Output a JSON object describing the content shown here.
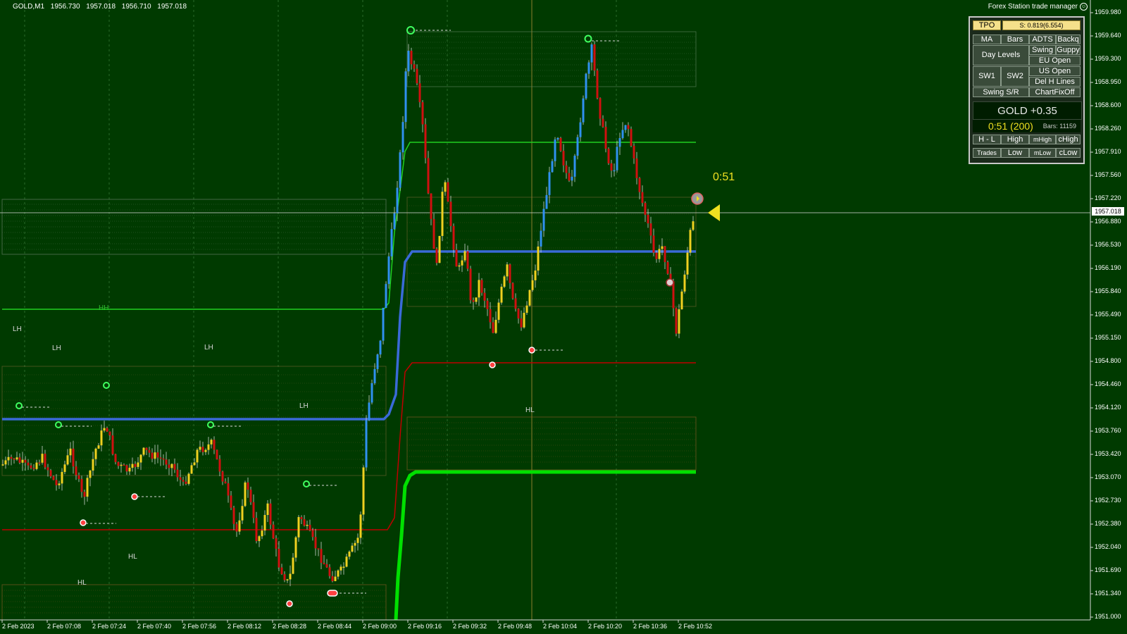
{
  "header": {
    "symbol": "GOLD,M1",
    "ohlc": [
      "1956.730",
      "1957.018",
      "1956.710",
      "1957.018"
    ]
  },
  "trade_manager": {
    "title": "Forex Station trade manager",
    "tpo_label": "TPO",
    "spread_label": "S: 0.819(6.554)",
    "buttons": {
      "ma": "MA",
      "bars": "Bars",
      "adts": "ADTS",
      "backq": "Backq",
      "day_levels": "Day Levels",
      "swing": "Swing",
      "guppy": "Guppy",
      "eu_open": "EU Open",
      "sw1": "SW1",
      "sw2": "SW2",
      "us_open": "US Open",
      "del_h_lines": "Del H Lines",
      "swing_sr": "Swing S/R",
      "chart_fix_off": "ChartFixOff",
      "h_l": "H - L",
      "high": "High",
      "mhigh": "mHigh",
      "chigh": "cHigh",
      "trades": "Trades",
      "low": "Low",
      "mlow": "mLow",
      "clow": "cLow"
    },
    "gold_display": "GOLD +0.35",
    "timer": "0:51 (200)",
    "bars_count": "Bars: 11159"
  },
  "countdown": "0:51",
  "price_axis": {
    "labels": [
      "1959.980",
      "1959.640",
      "1959.300",
      "1958.950",
      "1958.600",
      "1958.260",
      "1957.910",
      "1957.560",
      "1957.220",
      "1956.880",
      "1956.530",
      "1956.190",
      "1955.840",
      "1955.490",
      "1955.150",
      "1954.800",
      "1954.460",
      "1954.120",
      "1953.760",
      "1953.420",
      "1953.070",
      "1952.730",
      "1952.380",
      "1952.040",
      "1951.690",
      "1951.340",
      "1951.000"
    ],
    "current_price": "1957.018"
  },
  "time_axis": {
    "labels": [
      "2 Feb 2023",
      "2 Feb 07:08",
      "2 Feb 07:24",
      "2 Feb 07:40",
      "2 Feb 07:56",
      "2 Feb 08:12",
      "2 Feb 08:28",
      "2 Feb 08:44",
      "2 Feb 09:00",
      "2 Feb 09:16",
      "2 Feb 09:32",
      "2 Feb 09:48",
      "2 Feb 10:04",
      "2 Feb 10:20",
      "2 Feb 10:36",
      "2 Feb 10:52"
    ]
  },
  "swing_labels": [
    "LH",
    "LH",
    "LH",
    "LH",
    "HH",
    "HL",
    "HL",
    "HL"
  ],
  "colors": {
    "background": "#003a00",
    "bull": "#f0d020",
    "bear": "#d01010",
    "up_trend": "#3090f0",
    "blue_line": "#3a6ad8",
    "green_line": "#00e000",
    "red_line": "#c00000"
  }
}
